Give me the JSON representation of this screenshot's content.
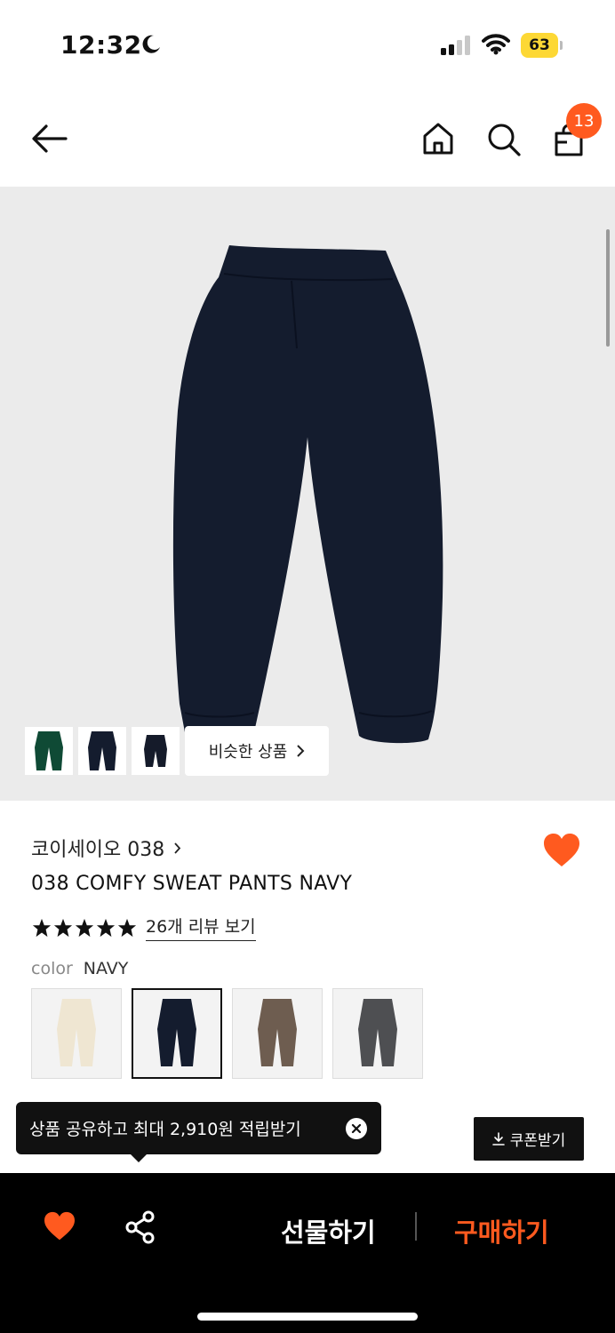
{
  "status_bar": {
    "time": "12:32",
    "battery": "63",
    "icons": [
      "moon-icon",
      "signal-icon",
      "wifi-icon",
      "battery-icon"
    ]
  },
  "header": {
    "cart_count": "13",
    "icons": [
      "back-arrow-icon",
      "home-icon",
      "search-icon",
      "shopping-bag-icon"
    ]
  },
  "gallery": {
    "similar_label": "비슷한 상품",
    "thumbnail_colors": [
      "#0f4a35",
      "#141c2e",
      "#151b2a"
    ]
  },
  "product": {
    "brand": "코이세이오 038",
    "name": "038 COMFY SWEAT PANTS NAVY",
    "rating": 5,
    "review_link": "26개 리뷰 보기",
    "color_label": "color",
    "color_value": "NAVY",
    "swatch_colors": [
      "#efe6d2",
      "#141c2e",
      "#6e5d50",
      "#4e4f52"
    ],
    "selected_swatch": 1,
    "like_color": "#ff5a1f"
  },
  "toast": {
    "text": "상품 공유하고 최대 2,910원 적립받기"
  },
  "coupon": {
    "label": "쿠폰받기"
  },
  "bottom_bar": {
    "gift_label": "선물하기",
    "buy_label": "구매하기",
    "accent_color": "#ff5a1f"
  }
}
